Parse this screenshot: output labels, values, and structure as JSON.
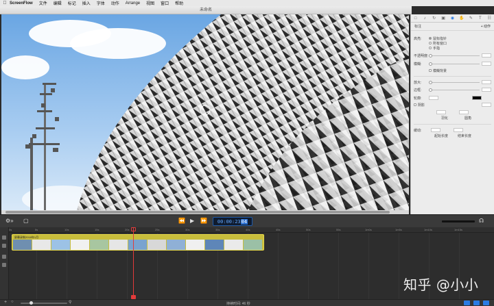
{
  "menubar": {
    "apple": "",
    "items": [
      "ScreenFlow",
      "文件",
      "编辑",
      "标记",
      "插入",
      "字体",
      "动作",
      "Arrange",
      "视图",
      "窗口",
      "帮助"
    ]
  },
  "window": {
    "title": "未命名"
  },
  "properties_panel": {
    "section_title": "标注",
    "add_action_label": "+ 动作",
    "shape_label": "高亮:",
    "radio_options": [
      "鼠标指针",
      "所有窗口",
      "手指"
    ],
    "opacity_label": "不透明度:",
    "blur_label": "模糊:",
    "blur_checkbox_label": "模糊背景",
    "zoom_label": "放大:",
    "border_label": "边框:",
    "outline_label": "轮廓:",
    "shadow_label": "阴影",
    "field_labels": [
      "羽化",
      "圆角"
    ],
    "duration_label": "缓动:",
    "ease_labels": [
      "起始长度",
      "结束长度"
    ],
    "outline_color": "#000000"
  },
  "transport": {
    "timecode": "00:00:23",
    "frames": "04"
  },
  "timeline": {
    "ruler_ticks": [
      "0s",
      "5s",
      "10s",
      "15s",
      "20s",
      "25s",
      "30s",
      "35s",
      "40s",
      "45s",
      "50s",
      "55s",
      "1m0s",
      "1m5s",
      "1m10s",
      "1m15s"
    ],
    "clip_title": "屏幕录制2018年1月",
    "duration_text": "持续时间: 46 秒"
  },
  "colors": {
    "accent": "#2a7be4",
    "playhead": "#e23b3b",
    "clip": "#e6d84a"
  },
  "watermark": "知乎 @小小"
}
